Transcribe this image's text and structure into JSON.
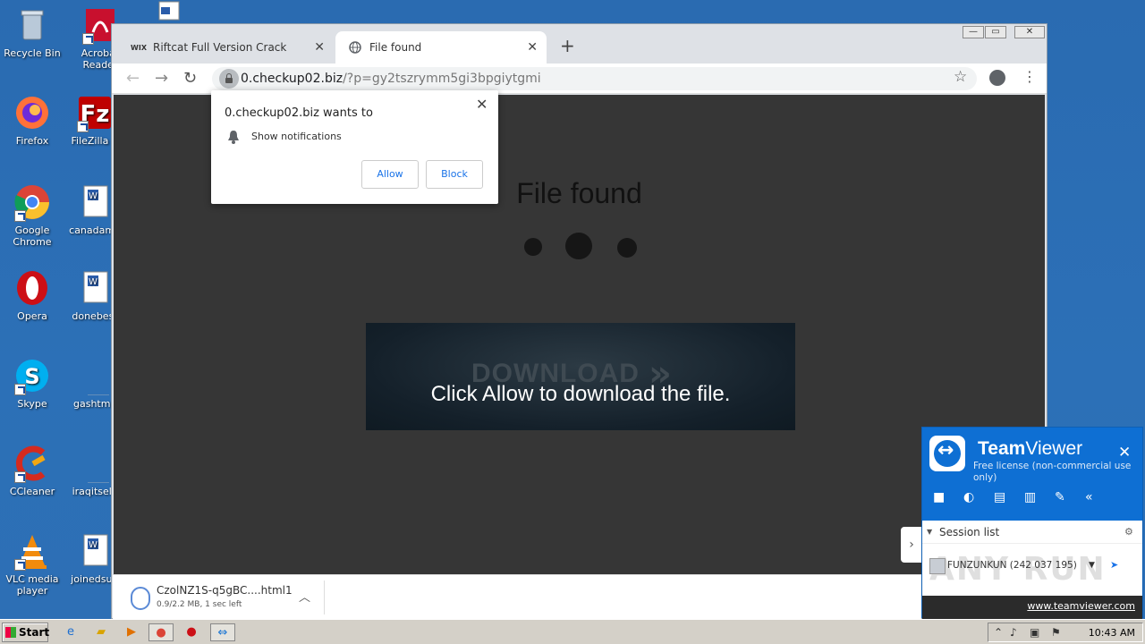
{
  "desktop": {
    "icons": [
      {
        "label": "Recycle Bin"
      },
      {
        "label": "Acrobat Reader"
      },
      {
        "label": "Firefox"
      },
      {
        "label": "FileZilla C"
      },
      {
        "label": "Google Chrome"
      },
      {
        "label": "canadame"
      },
      {
        "label": "Opera"
      },
      {
        "label": "donebest"
      },
      {
        "label": "Skype"
      },
      {
        "label": "gashtml."
      },
      {
        "label": "CCleaner"
      },
      {
        "label": "iraqitself."
      },
      {
        "label": "VLC media player"
      },
      {
        "label": "joinedsuit"
      }
    ]
  },
  "browser": {
    "tabs": [
      {
        "title": "Riftcat Full Version Crack",
        "favicon": "WIX"
      },
      {
        "title": "File found"
      }
    ],
    "address": {
      "host": "0.checkup02.biz",
      "path": "/?p=gy2tszrymm5gi3bpgiytgmi"
    },
    "window_controls": [
      "—",
      "▭",
      "✕"
    ]
  },
  "page": {
    "title": "File found",
    "download_ghost": "DOWNLOAD",
    "message": "Click Allow to download the file."
  },
  "notification": {
    "title": "0.checkup02.biz wants to",
    "permission": "Show notifications",
    "allow": "Allow",
    "block": "Block"
  },
  "download_shelf": {
    "filename": "CzolNZ1S-q5gBC....html1",
    "status": "0.9/2.2 MB, 1 sec left"
  },
  "teamviewer": {
    "name_bold": "Team",
    "name_rest": "Viewer",
    "license": "Free license (non-commercial use only)",
    "session_list": "Session list",
    "session": "FUNZUNKUN (242 037 195)",
    "watermark": "ANY RUN",
    "link": "www.teamviewer.com"
  },
  "taskbar": {
    "start": "Start",
    "clock": "10:43 AM"
  }
}
